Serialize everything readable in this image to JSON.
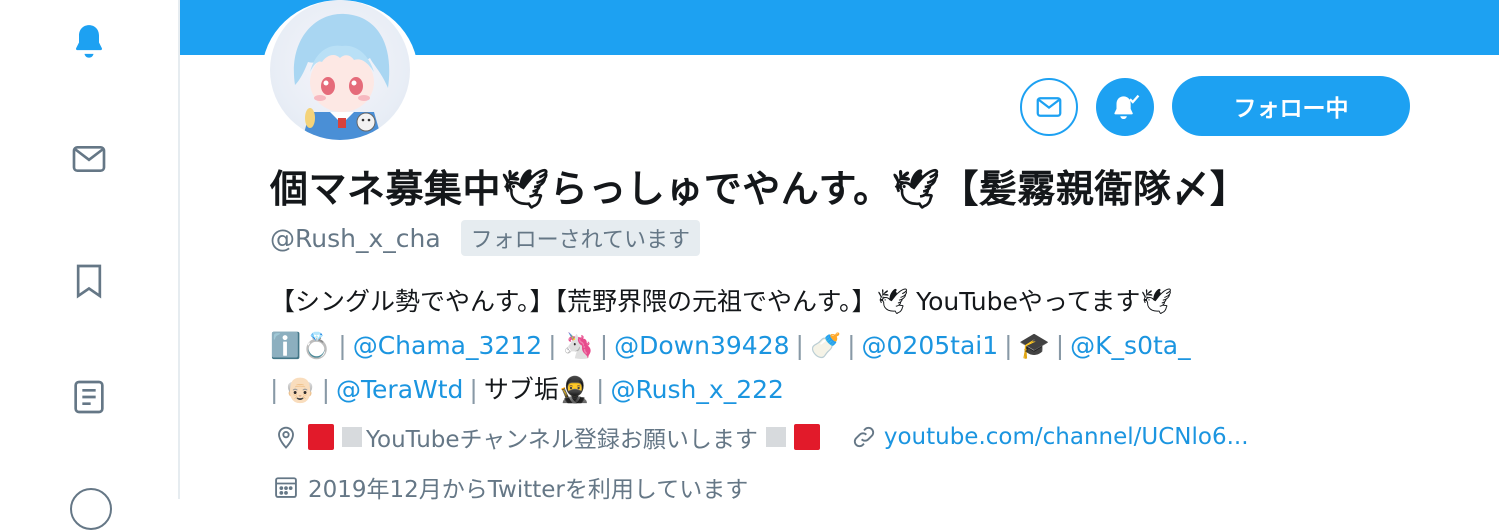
{
  "sidebar": {
    "items": [
      {
        "name": "notifications",
        "icon": "bell-icon",
        "active": true
      },
      {
        "name": "messages",
        "icon": "envelope-icon"
      },
      {
        "name": "bookmarks",
        "icon": "bookmark-icon"
      },
      {
        "name": "lists",
        "icon": "list-icon"
      }
    ]
  },
  "profile": {
    "display_name": "個マネ募集中🕊らっしゅでやんす。🕊【髪霧親衛隊〆】",
    "handle": "@Rush_x_cha",
    "follows_you_badge": "フォローされています",
    "follow_button_label": "フォロー中",
    "bio": {
      "line1": "【シングル勢でやんす。】【荒野界隈の元祖でやんす。】🕊 YouTubeやってます🕊",
      "line2": [
        {
          "emoji": "ℹ️💍",
          "mention": "@Chama_3212"
        },
        {
          "emoji": "🦄",
          "mention": "@Down39428"
        },
        {
          "emoji": "🍼",
          "mention": "@0205tai1"
        },
        {
          "emoji": "🎓",
          "mention": "@K_s0ta_"
        }
      ],
      "line3_emoji": "👴🏻",
      "line3_mention1": "@TeraWtd",
      "line3_text": "サブ垢🥷",
      "line3_mention2": "@Rush_x_222"
    },
    "location": "YouTubeチャンネル登録お願いします",
    "website": "youtube.com/channel/UCNlo6...",
    "joined": "2019年12月からTwitterを利用しています"
  },
  "colors": {
    "accent": "#1da1f2",
    "link": "#1b95e0",
    "muted": "#657786"
  }
}
